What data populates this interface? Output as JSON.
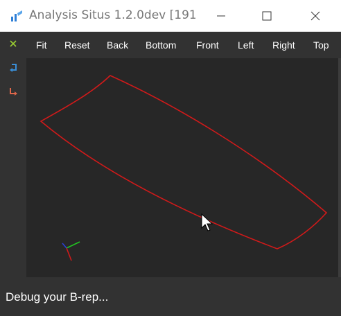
{
  "window": {
    "title": "Analysis Situs 1.2.0dev [191...",
    "accent": "#2f7fd6"
  },
  "toolbar": {
    "items": [
      {
        "label": "Fit"
      },
      {
        "label": "Reset"
      },
      {
        "label": "Back"
      },
      {
        "label": "Bottom"
      },
      {
        "label": "Front"
      },
      {
        "label": "Left"
      },
      {
        "label": "Right"
      },
      {
        "label": "Top"
      }
    ]
  },
  "tools": [
    {
      "icon": "close-x-icon",
      "color": "#9acd32"
    },
    {
      "icon": "undo-icon",
      "color": "#3a8fd8"
    },
    {
      "icon": "redo-icon",
      "color": "#e0674a"
    }
  ],
  "viewport": {
    "background": "#272727",
    "shape_color": "#d11a1a",
    "triad_colors": {
      "x": "#d11a1a",
      "y": "#22c422",
      "z": "#2a3fd6"
    }
  },
  "status": {
    "message": "Debug your B-rep..."
  }
}
